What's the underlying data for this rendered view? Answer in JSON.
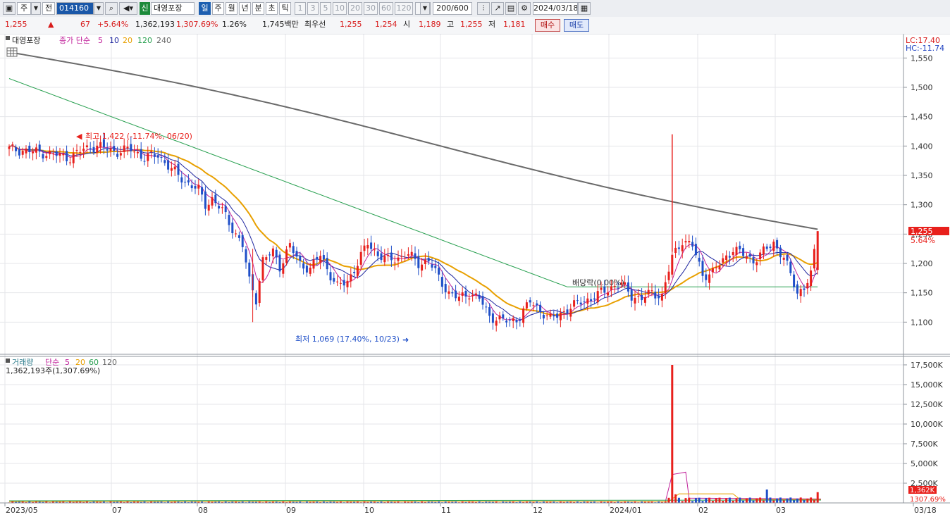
{
  "toolbar": {
    "market": "주",
    "market_scope": "전",
    "stock_code": "014160",
    "badge_new": "신",
    "stock_name": "대영포장",
    "periods": [
      "일",
      "주",
      "월",
      "년",
      "분",
      "초",
      "틱"
    ],
    "minutes": [
      "1",
      "3",
      "5",
      "10",
      "20",
      "30",
      "60",
      "120"
    ],
    "count": "200/600",
    "date": "2024/03/18"
  },
  "quote": {
    "price": "1,255",
    "arrow": "▲",
    "change": "67",
    "change_pct": "+5.64%",
    "volume": "1,362,193",
    "volume_ratio": "1,307.69%",
    "turnover": "1.26%",
    "value": "1,745백만",
    "best_label": "최우선",
    "ask": "1,255",
    "bid": "1,254",
    "open_label": "시",
    "open": "1,189",
    "high_label": "고",
    "high": "1,255",
    "low_label": "저",
    "low": "1,181",
    "buy_label": "매수",
    "sell_label": "매도"
  },
  "price_panel": {
    "legend_name": "대영포장",
    "legend_series": "종가 단순",
    "ma_periods": [
      "5",
      "10",
      "20",
      "120",
      "240"
    ],
    "lc": "LC:17.40",
    "hc": "HC:-11.74",
    "y_ticks": [
      "1,550",
      "1,500",
      "1,450",
      "1,400",
      "1,350",
      "1,300",
      "1,250",
      "1,200",
      "1,150",
      "1,100"
    ],
    "last_price": "1,255",
    "last_pct": "5.64%",
    "high_note": "최고 1,422 (-11.74%, 06/20)",
    "low_note": "최저 1,069 (17.40%, 10/23)",
    "dividend_note": "배당락(0.00%)"
  },
  "volume_panel": {
    "legend_name": "거래량",
    "legend_series": "단순",
    "ma_periods": [
      "5",
      "20",
      "60",
      "120"
    ],
    "current": "1,362,193주(1,307.69%)",
    "y_ticks": [
      "17,500K",
      "15,000K",
      "12,500K",
      "10,000K",
      "7,500K",
      "5,000K",
      "2,500K"
    ],
    "last_volume": "1,362K",
    "last_pct": "1307.69%"
  },
  "x_axis": [
    "2023/05",
    "07",
    "08",
    "09",
    "10",
    "11",
    "12",
    "2024/01",
    "02",
    "03",
    "03/18"
  ],
  "colors": {
    "up": "#e8201c",
    "down": "#1f4fc8",
    "ma5": "#c0209a",
    "ma10": "#2028a0",
    "ma20": "#e8a000",
    "ma120": "#28a050",
    "ma240": "#6a6a6a"
  },
  "chart_data": {
    "type": "candlestick",
    "period": "daily",
    "x_range": [
      "2023/05",
      "2024/03/18"
    ],
    "ylim": [
      1050,
      1570
    ],
    "last": {
      "open": 1189,
      "high": 1255,
      "low": 1181,
      "close": 1255
    },
    "period_high": {
      "value": 1422,
      "date": "06/20"
    },
    "period_low": {
      "value": 1069,
      "date": "10/23"
    },
    "close_path": [
      [
        0,
        1395
      ],
      [
        8,
        1390
      ],
      [
        14,
        1385
      ],
      [
        18,
        1380
      ],
      [
        22,
        1395
      ],
      [
        26,
        1400
      ],
      [
        32,
        1390
      ],
      [
        36,
        1395
      ],
      [
        40,
        1380
      ],
      [
        44,
        1385
      ],
      [
        48,
        1360
      ],
      [
        52,
        1340
      ],
      [
        56,
        1325
      ],
      [
        58,
        1300
      ],
      [
        60,
        1310
      ],
      [
        63,
        1290
      ],
      [
        66,
        1260
      ],
      [
        69,
        1230
      ],
      [
        71,
        1170
      ],
      [
        73,
        1140
      ],
      [
        75,
        1205
      ],
      [
        78,
        1220
      ],
      [
        80,
        1195
      ],
      [
        83,
        1230
      ],
      [
        86,
        1200
      ],
      [
        89,
        1190
      ],
      [
        92,
        1215
      ],
      [
        95,
        1180
      ],
      [
        97,
        1160
      ],
      [
        100,
        1170
      ],
      [
        103,
        1200
      ],
      [
        106,
        1235
      ],
      [
        109,
        1215
      ],
      [
        112,
        1205
      ],
      [
        115,
        1210
      ],
      [
        118,
        1215
      ],
      [
        121,
        1200
      ],
      [
        124,
        1205
      ],
      [
        127,
        1175
      ],
      [
        130,
        1150
      ],
      [
        133,
        1140
      ],
      [
        136,
        1150
      ],
      [
        139,
        1140
      ],
      [
        142,
        1110
      ],
      [
        145,
        1105
      ],
      [
        148,
        1100
      ],
      [
        151,
        1110
      ],
      [
        154,
        1135
      ],
      [
        157,
        1120
      ],
      [
        160,
        1105
      ],
      [
        163,
        1115
      ],
      [
        166,
        1125
      ],
      [
        169,
        1135
      ],
      [
        172,
        1140
      ],
      [
        175,
        1150
      ],
      [
        178,
        1160
      ],
      [
        181,
        1165
      ],
      [
        184,
        1145
      ],
      [
        187,
        1140
      ],
      [
        190,
        1150
      ],
      [
        193,
        1145
      ],
      [
        196,
        1210
      ],
      [
        199,
        1240
      ],
      [
        202,
        1230
      ],
      [
        205,
        1180
      ],
      [
        208,
        1185
      ],
      [
        211,
        1205
      ],
      [
        214,
        1225
      ],
      [
        217,
        1215
      ],
      [
        220,
        1205
      ],
      [
        223,
        1220
      ],
      [
        226,
        1235
      ],
      [
        229,
        1210
      ],
      [
        231,
        1180
      ],
      [
        233,
        1150
      ],
      [
        235,
        1160
      ],
      [
        237,
        1180
      ],
      [
        239,
        1255
      ]
    ],
    "volume_peak": 17500,
    "volume_last": 1362
  }
}
